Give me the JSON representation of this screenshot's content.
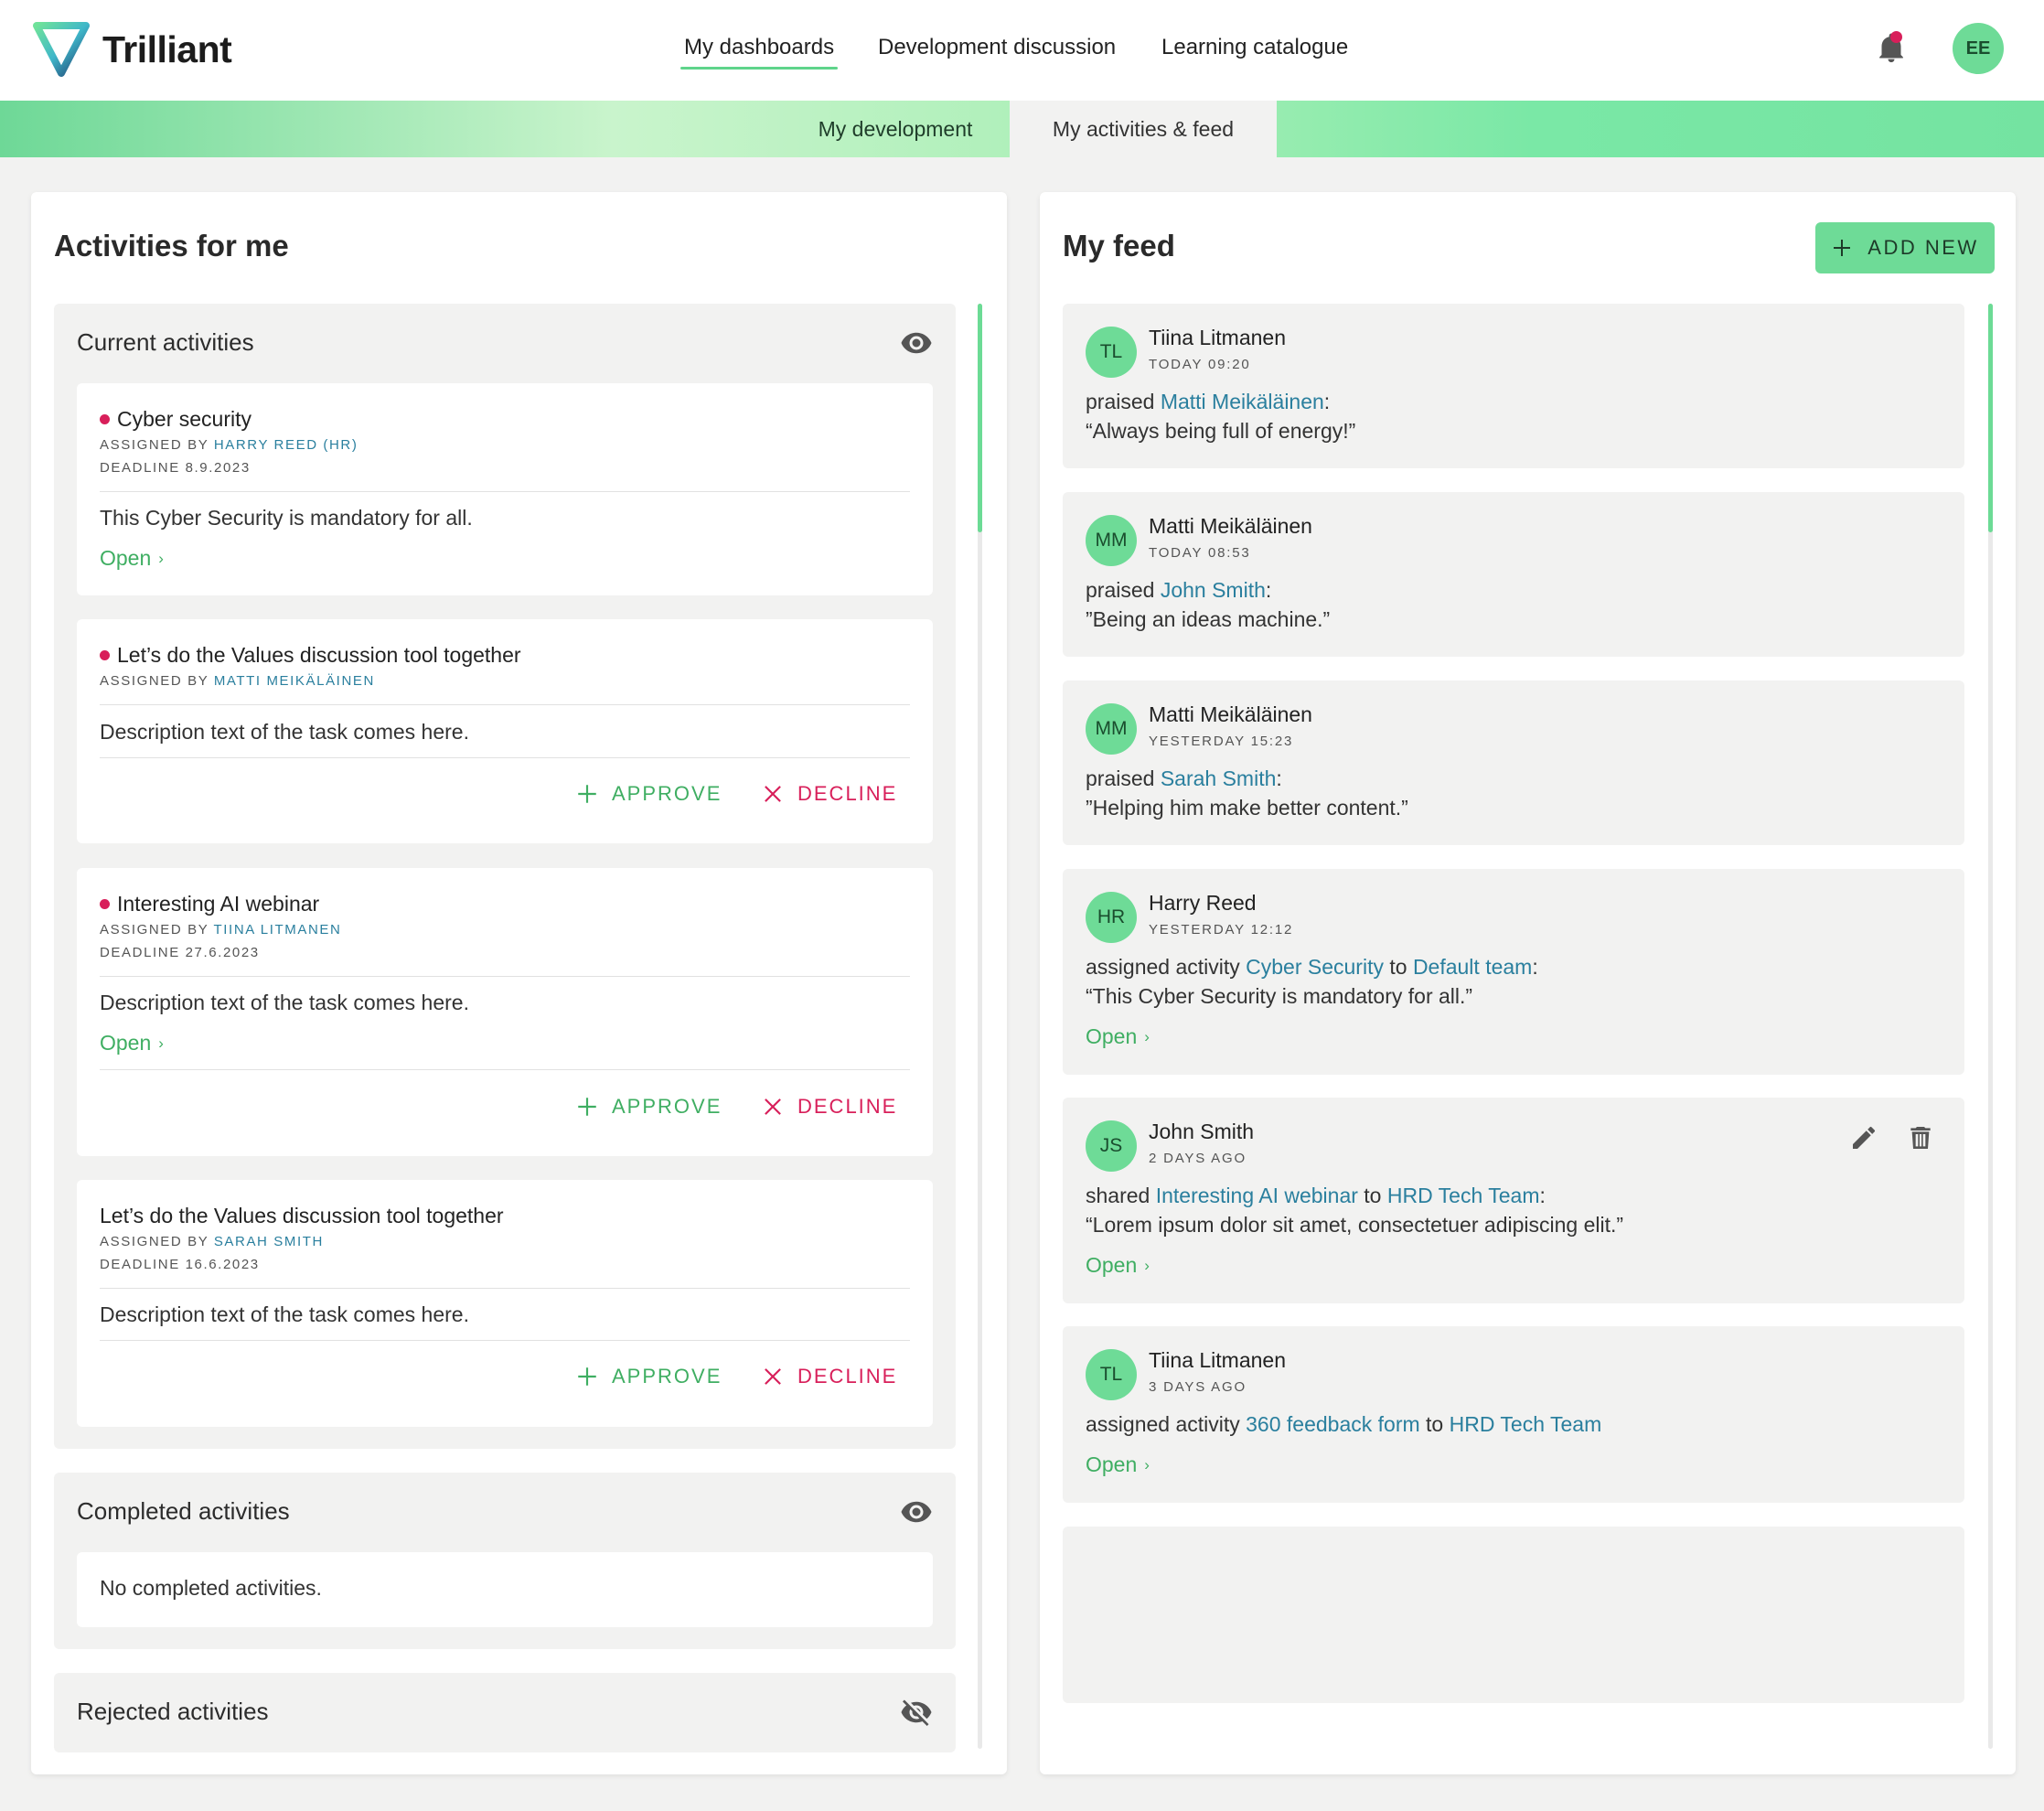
{
  "brand": {
    "name": "Trilliant"
  },
  "nav": [
    {
      "label": "My dashboards",
      "active": true
    },
    {
      "label": "Development discussion",
      "active": false
    },
    {
      "label": "Learning catalogue",
      "active": false
    }
  ],
  "user": {
    "initials": "EE"
  },
  "subnav": [
    {
      "label": "My development",
      "active": false
    },
    {
      "label": "My activities & feed",
      "active": true
    }
  ],
  "activities": {
    "title": "Activities for me",
    "current": {
      "title": "Current activities",
      "cards": [
        {
          "title": "Cyber security",
          "assigned_prefix": "ASSIGNED BY",
          "assigned_by": "HARRY REED (HR)",
          "deadline": "DEADLINE 8.9.2023",
          "description": "This Cyber Security is mandatory for all.",
          "open": "Open"
        },
        {
          "title": "Let’s do the Values discussion tool together",
          "assigned_prefix": "ASSIGNED BY",
          "assigned_by": "MATTI MEIKÄLÄINEN",
          "description": "Description text of the task comes here.",
          "approve": "APPROVE",
          "decline": "DECLINE"
        },
        {
          "title": "Interesting AI webinar",
          "assigned_prefix": "ASSIGNED BY",
          "assigned_by": "TIINA LITMANEN",
          "deadline": "DEADLINE 27.6.2023",
          "description": "Description text of the task comes here.",
          "open": "Open",
          "approve": "APPROVE",
          "decline": "DECLINE"
        },
        {
          "title": "Let’s do the Values discussion tool together",
          "assigned_prefix": "ASSIGNED BY",
          "assigned_by": "SARAH SMITH",
          "deadline": "DEADLINE 16.6.2023",
          "description": "Description text of the task comes here.",
          "approve": "APPROVE",
          "decline": "DECLINE"
        }
      ]
    },
    "completed": {
      "title": "Completed activities",
      "empty": "No completed activities."
    },
    "rejected": {
      "title": "Rejected activities"
    }
  },
  "feed": {
    "title": "My feed",
    "add_new": "ADD NEW",
    "items": [
      {
        "initials": "TL",
        "name": "Tiina Litmanen",
        "time": "TODAY 09:20",
        "verb": "praised",
        "target": "Matti Meikäläinen",
        "quote": "“Always being full of energy!”"
      },
      {
        "initials": "MM",
        "name": "Matti Meikäläinen",
        "time": "TODAY 08:53",
        "verb": "praised",
        "target": "John Smith",
        "quote": "”Being an ideas machine.”"
      },
      {
        "initials": "MM",
        "name": "Matti Meikäläinen",
        "time": "YESTERDAY 15:23",
        "verb": "praised",
        "target": "Sarah Smith",
        "quote": "”Helping him make better content.”"
      },
      {
        "initials": "HR",
        "name": "Harry Reed",
        "time": "YESTERDAY 12:12",
        "verb": "assigned activity",
        "target": "Cyber Security",
        "to": "to",
        "target2": "Default team",
        "quote": "“This Cyber Security is mandatory for all.”",
        "open": "Open"
      },
      {
        "initials": "JS",
        "name": "John Smith",
        "time": "2 DAYS AGO",
        "verb": "shared",
        "target": "Interesting AI webinar",
        "to": "to",
        "target2": "HRD Tech Team",
        "quote": "“Lorem ipsum dolor sit amet, consectetuer adipiscing elit.”",
        "open": "Open"
      },
      {
        "initials": "TL",
        "name": "Tiina Litmanen",
        "time": "3 DAYS AGO",
        "verb": "assigned activity",
        "target": "360 feedback form",
        "to": "to",
        "target2": "HRD Tech Team",
        "open": "Open"
      }
    ]
  },
  "colors": {
    "accent": "#6edb97",
    "link": "#2a7f9e",
    "open": "#3fae62",
    "decline": "#d81f5a"
  }
}
